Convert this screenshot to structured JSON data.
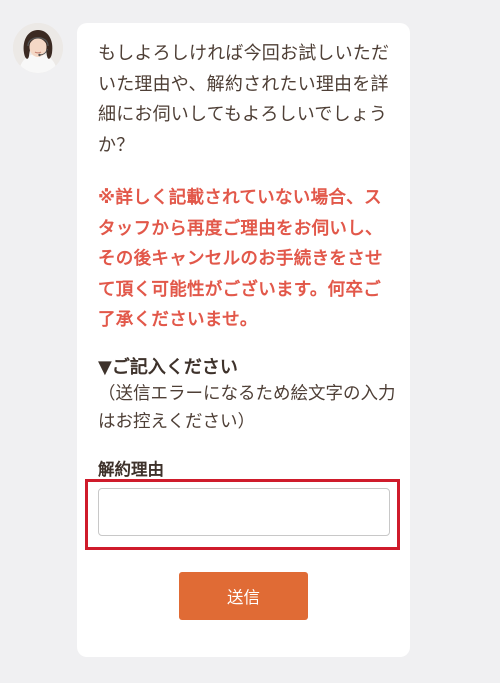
{
  "chat": {
    "intro_text": "もしよろしければ今回お試しいただいた理由や、解約されたい理由を詳細にお伺いしてもよろしいでしょうか？",
    "warning_text": "※詳しく記載されていない場合、スタッフから再度ご理由をお伺いし、その後キャンセルのお手続きをさせて頂く可能性がございます。何卒ご了承くださいませ。",
    "section_heading": "▼ご記入ください",
    "section_note": "（送信エラーになるため絵文字の入力はお控えください）"
  },
  "form": {
    "field_label": "解約理由",
    "field_value": "",
    "submit_label": "送信"
  },
  "colors": {
    "warning": "#e2584a",
    "submit_button": "#e06b35",
    "highlight_border": "#cf1b2b"
  },
  "icons": {
    "avatar": "operator-avatar-icon"
  }
}
